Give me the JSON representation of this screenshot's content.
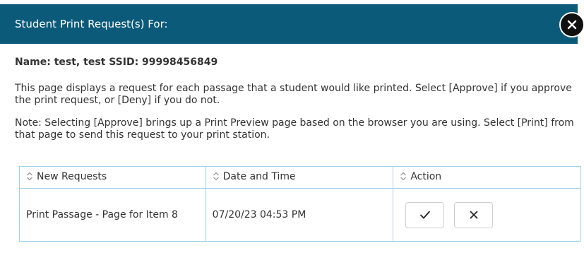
{
  "dialog": {
    "title": "Student Print Request(s) For:",
    "student_line": "Name: test, test SSID: 99998456849",
    "description": "This page displays a request for each passage that a student would like printed. Select [Approve] if you approve the print request, or [Deny] if you do not.",
    "note": "Note: Selecting [Approve] brings up a Print Preview page based on the browser you are using. Select [Print] from that page to send this request to your print station."
  },
  "table": {
    "columns": [
      "New Requests",
      "Date and Time",
      "Action"
    ],
    "rows": [
      {
        "request": "Print Passage - Page for Item 8",
        "datetime": "07/20/23 04:53 PM"
      }
    ]
  },
  "icons": {
    "close": "close-icon",
    "sort": "sort-icon",
    "approve": "checkmark-icon",
    "deny": "x-icon"
  },
  "colors": {
    "header_bg": "#0b5a7a",
    "table_border": "#9ed3ea"
  }
}
